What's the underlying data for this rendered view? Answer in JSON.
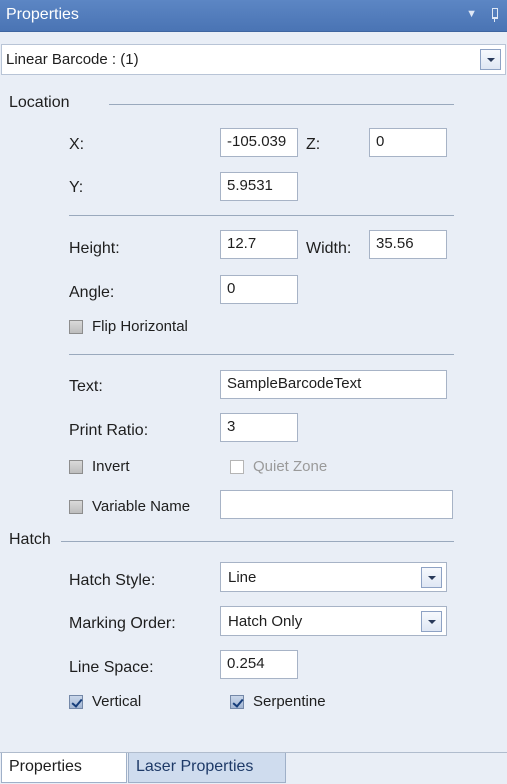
{
  "panel": {
    "title": "Properties"
  },
  "selector": {
    "value": "Linear Barcode : (1)"
  },
  "location": {
    "group_label": "Location",
    "x_label": "X:",
    "x_value": "-105.039",
    "z_label": "Z:",
    "z_value": "0",
    "y_label": "Y:",
    "y_value": "5.9531",
    "height_label": "Height:",
    "height_value": "12.7",
    "width_label": "Width:",
    "width_value": "35.56",
    "angle_label": "Angle:",
    "angle_value": "0",
    "flip_label": "Flip Horizontal",
    "flip_checked": false,
    "text_label": "Text:",
    "text_value": "SampleBarcodeText",
    "print_ratio_label": "Print Ratio:",
    "print_ratio_value": "3",
    "invert_label": "Invert",
    "invert_checked": false,
    "quiet_zone_label": "Quiet Zone",
    "quiet_zone_checked": false,
    "variable_name_label": "Variable Name",
    "variable_name_checked": false,
    "variable_name_value": ""
  },
  "hatch": {
    "group_label": "Hatch",
    "style_label": "Hatch Style:",
    "style_value": "Line",
    "order_label": "Marking Order:",
    "order_value": "Hatch Only",
    "line_space_label": "Line Space:",
    "line_space_value": "0.254",
    "vertical_label": "Vertical",
    "vertical_checked": true,
    "serpentine_label": "Serpentine",
    "serpentine_checked": true
  },
  "tabs": [
    {
      "label": "Properties",
      "active": true
    },
    {
      "label": "Laser Properties",
      "active": false
    }
  ],
  "colors": {
    "title_bar": "#4f79b9",
    "panel_bg": "#e9eef6",
    "tab_inactive": "#cfdcee"
  }
}
